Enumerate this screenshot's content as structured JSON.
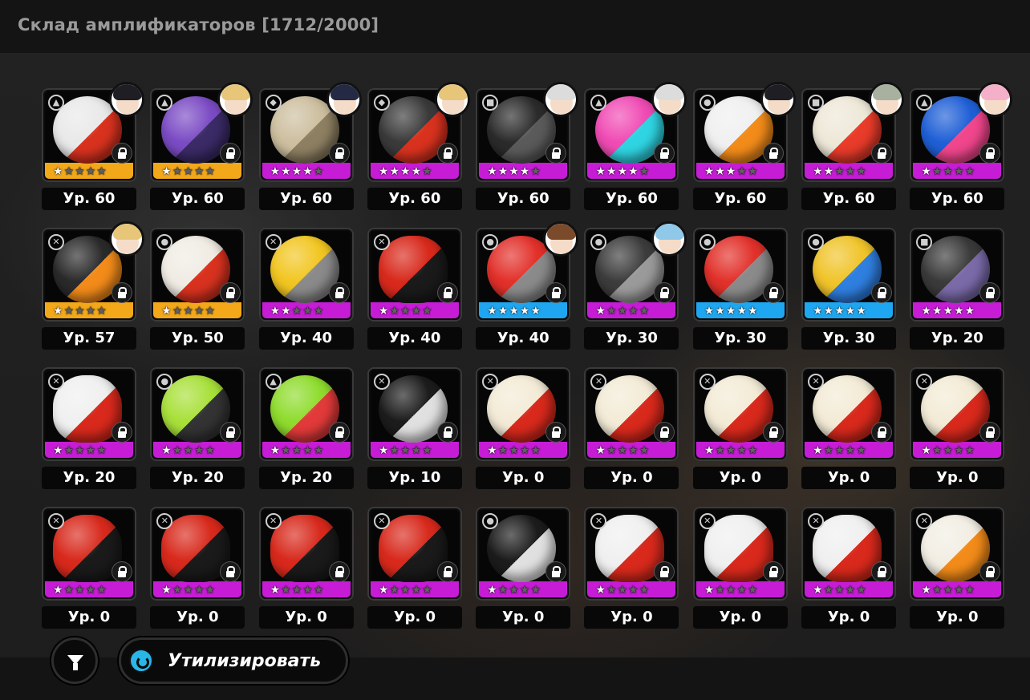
{
  "header": {
    "title": "Склад амплификаторов [1712/2000]"
  },
  "colors": {
    "rarity_gold": "#f3a81a",
    "rarity_purple": "#c61cd6",
    "rarity_blue": "#1ea7f0"
  },
  "amplifiers": [
    {
      "level": "Ур. 60",
      "rarity": "gold",
      "stars": 1,
      "icon": "ball-white-red",
      "avatar": "dark-hair",
      "type": "a"
    },
    {
      "level": "Ур. 60",
      "rarity": "gold",
      "stars": 1,
      "icon": "tentacle-purple",
      "avatar": "blond-hair",
      "type": "a"
    },
    {
      "level": "Ур. 60",
      "rarity": "purple",
      "stars": 4,
      "icon": "fossil-stone",
      "avatar": "navy-hair",
      "type": "b"
    },
    {
      "level": "Ур. 60",
      "rarity": "purple",
      "stars": 4,
      "icon": "ball-black-red",
      "avatar": "blond-hair",
      "type": "b"
    },
    {
      "level": "Ур. 60",
      "rarity": "purple",
      "stars": 4,
      "icon": "ball-dark-gear",
      "avatar": "white-hair",
      "type": "c"
    },
    {
      "level": "Ур. 60",
      "rarity": "purple",
      "stars": 4,
      "icon": "ball-pink-cyan",
      "avatar": "white-hair",
      "type": "a"
    },
    {
      "level": "Ур. 60",
      "rarity": "purple",
      "stars": 3,
      "icon": "ball-camera-orange",
      "avatar": "dark-hair",
      "type": "d"
    },
    {
      "level": "Ур. 60",
      "rarity": "purple",
      "stars": 2,
      "icon": "ball-star-badge",
      "avatar": "grey-hair",
      "type": "c"
    },
    {
      "level": "Ур. 60",
      "rarity": "purple",
      "stars": 1,
      "icon": "lips-pink",
      "avatar": "pink-hair",
      "type": "a"
    },
    {
      "level": "Ур. 57",
      "rarity": "gold",
      "stars": 1,
      "icon": "ball-black-orange",
      "avatar": "blond-hair",
      "type": "e"
    },
    {
      "level": "Ур. 50",
      "rarity": "gold",
      "stars": 1,
      "icon": "ball-white-red-dots",
      "avatar": "",
      "type": "d"
    },
    {
      "level": "Ур. 40",
      "rarity": "purple",
      "stars": 2,
      "icon": "ball-yellow-lock",
      "avatar": "",
      "type": "e"
    },
    {
      "level": "Ур. 40",
      "rarity": "purple",
      "stars": 1,
      "icon": "helmet-red",
      "avatar": "",
      "type": "e"
    },
    {
      "level": "Ур. 40",
      "rarity": "blue",
      "stars": 5,
      "icon": "ball-red-triangle",
      "avatar": "brown-hair",
      "type": "d"
    },
    {
      "level": "Ур. 30",
      "rarity": "purple",
      "stars": 1,
      "icon": "ball-grey-spiky",
      "avatar": "blue-hair",
      "type": "d"
    },
    {
      "level": "Ур. 30",
      "rarity": "blue",
      "stars": 5,
      "icon": "ball-red-triangle",
      "avatar": "",
      "type": "d"
    },
    {
      "level": "Ур. 30",
      "rarity": "blue",
      "stars": 5,
      "icon": "ball-yellow-triangle",
      "avatar": "",
      "type": "d"
    },
    {
      "level": "Ур. 20",
      "rarity": "purple",
      "stars": 5,
      "icon": "ball-dark-ears",
      "avatar": "",
      "type": "c"
    },
    {
      "level": "Ур. 20",
      "rarity": "purple",
      "stars": 1,
      "icon": "helmet-white-red",
      "avatar": "",
      "type": "e"
    },
    {
      "level": "Ур. 20",
      "rarity": "purple",
      "stars": 1,
      "icon": "ball-green-mask",
      "avatar": "",
      "type": "d"
    },
    {
      "level": "Ур. 20",
      "rarity": "purple",
      "stars": 1,
      "icon": "ball-green-chomper",
      "avatar": "",
      "type": "a"
    },
    {
      "level": "Ур. 10",
      "rarity": "purple",
      "stars": 1,
      "icon": "ball-black-robot",
      "avatar": "",
      "type": "e"
    },
    {
      "level": "Ур. 0",
      "rarity": "purple",
      "stars": 1,
      "icon": "ball-cream-face",
      "avatar": "",
      "type": "e"
    },
    {
      "level": "Ур. 0",
      "rarity": "purple",
      "stars": 1,
      "icon": "ball-cream-face",
      "avatar": "",
      "type": "e"
    },
    {
      "level": "Ур. 0",
      "rarity": "purple",
      "stars": 1,
      "icon": "ball-cream-face",
      "avatar": "",
      "type": "e"
    },
    {
      "level": "Ур. 0",
      "rarity": "purple",
      "stars": 1,
      "icon": "ball-cream-face",
      "avatar": "",
      "type": "e"
    },
    {
      "level": "Ур. 0",
      "rarity": "purple",
      "stars": 1,
      "icon": "ball-cream-face",
      "avatar": "",
      "type": "e"
    },
    {
      "level": "Ур. 0",
      "rarity": "purple",
      "stars": 1,
      "icon": "helmet-red",
      "avatar": "",
      "type": "e"
    },
    {
      "level": "Ур. 0",
      "rarity": "purple",
      "stars": 1,
      "icon": "helmet-red",
      "avatar": "",
      "type": "e"
    },
    {
      "level": "Ур. 0",
      "rarity": "purple",
      "stars": 1,
      "icon": "helmet-red",
      "avatar": "",
      "type": "e"
    },
    {
      "level": "Ур. 0",
      "rarity": "purple",
      "stars": 1,
      "icon": "helmet-red",
      "avatar": "",
      "type": "e"
    },
    {
      "level": "Ур. 0",
      "rarity": "purple",
      "stars": 1,
      "icon": "ball-black-robot",
      "avatar": "",
      "type": "d"
    },
    {
      "level": "Ур. 0",
      "rarity": "purple",
      "stars": 1,
      "icon": "helmet-white-red",
      "avatar": "",
      "type": "e"
    },
    {
      "level": "Ур. 0",
      "rarity": "purple",
      "stars": 1,
      "icon": "helmet-white-red",
      "avatar": "",
      "type": "e"
    },
    {
      "level": "Ур. 0",
      "rarity": "purple",
      "stars": 1,
      "icon": "helmet-white-red",
      "avatar": "",
      "type": "e"
    },
    {
      "level": "Ур. 0",
      "rarity": "purple",
      "stars": 1,
      "icon": "bowl-food",
      "avatar": "",
      "type": "e"
    }
  ],
  "footer": {
    "filter_icon": "filter-funnel-icon",
    "recycle_icon": "recycle-icon",
    "recycle_label": "Утилизировать"
  }
}
